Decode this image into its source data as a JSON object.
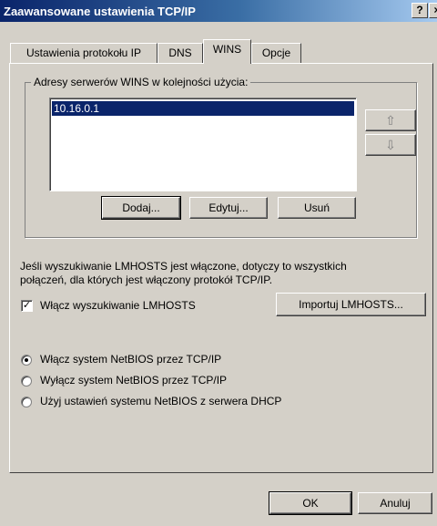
{
  "window": {
    "title": "Zaawansowane ustawienia TCP/IP",
    "help_glyph": "?",
    "close_glyph": "×"
  },
  "tabs": [
    {
      "label": "Ustawienia protokołu IP"
    },
    {
      "label": "DNS"
    },
    {
      "label": "WINS"
    },
    {
      "label": "Opcje"
    }
  ],
  "wins": {
    "group_label": "Adresy serwerów WINS w kolejności użycia:",
    "servers": [
      "10.16.0.1"
    ],
    "move_up_glyph": "⇧",
    "move_down_glyph": "⇩",
    "add_label": "Dodaj...",
    "edit_label": "Edytuj...",
    "remove_label": "Usuń"
  },
  "lmhosts": {
    "description_line1": "Jeśli wyszukiwanie LMHOSTS jest włączone, dotyczy to wszystkich",
    "description_line2": "połączeń, dla których jest włączony protokół TCP/IP.",
    "enable_label": "Włącz wyszukiwanie LMHOSTS",
    "enable_checked": true,
    "check_glyph": "✓",
    "import_label": "Importuj LMHOSTS..."
  },
  "netbios": {
    "options": [
      {
        "label": "Włącz system NetBIOS przez TCP/IP",
        "selected": true
      },
      {
        "label": "Wyłącz system NetBIOS przez TCP/IP",
        "selected": false
      },
      {
        "label": "Użyj ustawień systemu NetBIOS z serwera DHCP",
        "selected": false
      }
    ]
  },
  "footer": {
    "ok_label": "OK",
    "cancel_label": "Anuluj"
  },
  "colors": {
    "face": "#d4d0c8",
    "title_start": "#0a246a",
    "selection": "#0a246a"
  }
}
